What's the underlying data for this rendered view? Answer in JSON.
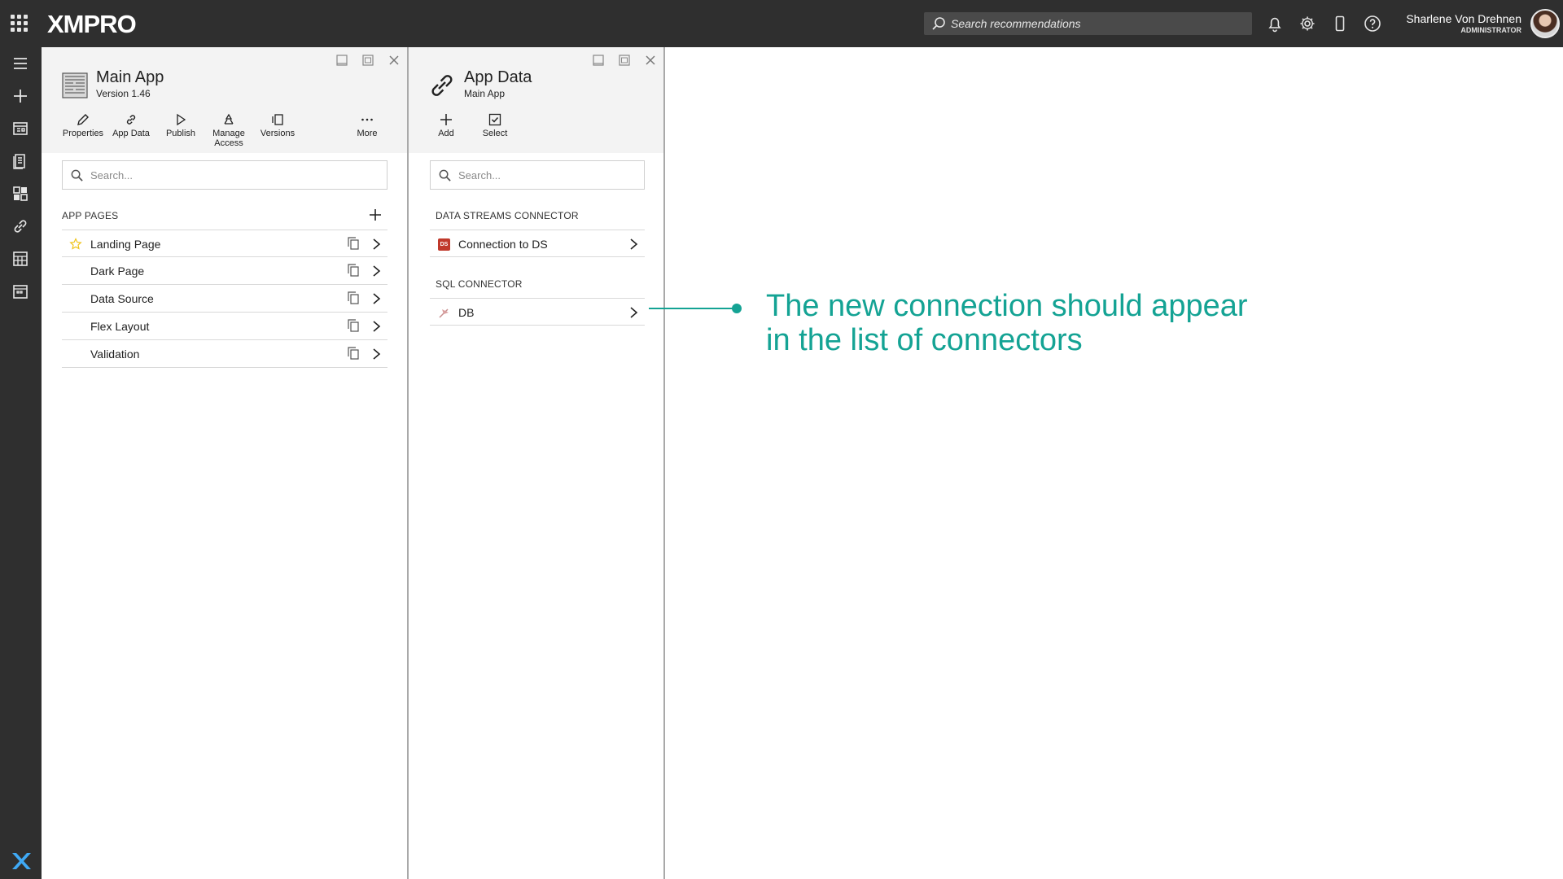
{
  "app": {
    "logo_text": "XMPRO",
    "search_placeholder": "Search recommendations",
    "user": {
      "name": "Sharlene Von Drehnen",
      "role": "ADMINISTRATOR"
    }
  },
  "main_panel": {
    "title": "Main App",
    "subtitle": "Version 1.46",
    "toolbar": [
      {
        "label": "Properties",
        "icon": "pencil-icon"
      },
      {
        "label": "App Data",
        "icon": "link-icon"
      },
      {
        "label": "Publish",
        "icon": "play-icon"
      },
      {
        "label": "Manage Access",
        "icon": "recycle-icon"
      },
      {
        "label": "Versions",
        "icon": "versions-icon"
      },
      {
        "label": "More",
        "icon": "more-icon"
      }
    ],
    "search_placeholder": "Search...",
    "section_label": "APP PAGES",
    "pages": [
      {
        "label": "Landing Page",
        "starred": true
      },
      {
        "label": "Dark Page"
      },
      {
        "label": "Data Source"
      },
      {
        "label": "Flex Layout"
      },
      {
        "label": "Validation"
      }
    ]
  },
  "data_panel": {
    "title": "App Data",
    "subtitle": "Main App",
    "toolbar": [
      {
        "label": "Add",
        "icon": "plus-icon"
      },
      {
        "label": "Select",
        "icon": "checkbox-icon"
      }
    ],
    "search_placeholder": "Search...",
    "sections": [
      {
        "label": "DATA STREAMS CONNECTOR",
        "items": [
          {
            "label": "Connection to DS",
            "icon": "ds-badge-icon",
            "badge": "DS"
          }
        ]
      },
      {
        "label": "SQL CONNECTOR",
        "items": [
          {
            "label": "DB",
            "icon": "sql-connector-icon"
          }
        ]
      }
    ]
  },
  "annotation": {
    "line1": "The new connection should appear",
    "line2": "in the list of connectors"
  },
  "colors": {
    "topbar": "#2f2f2f",
    "accent": "#14a394",
    "star": "#f0c419",
    "ds_badge": "#c0392b"
  }
}
